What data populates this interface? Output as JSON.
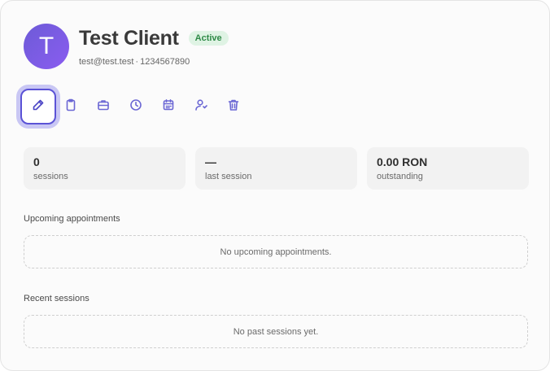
{
  "client": {
    "initial": "T",
    "name": "Test Client",
    "status": "Active",
    "email": "test@test.test",
    "separator": "·",
    "phone": "1234567890"
  },
  "toolbar": [
    {
      "name": "edit",
      "icon": "pencil-icon"
    },
    {
      "name": "notes",
      "icon": "clipboard-icon"
    },
    {
      "name": "briefcase",
      "icon": "briefcase-icon"
    },
    {
      "name": "history",
      "icon": "clock-icon"
    },
    {
      "name": "calendar",
      "icon": "calendar-icon"
    },
    {
      "name": "user",
      "icon": "user-icon"
    },
    {
      "name": "delete",
      "icon": "trash-icon"
    }
  ],
  "stats": [
    {
      "value": "0",
      "label": "sessions"
    },
    {
      "value": "—",
      "label": "last session"
    },
    {
      "value": "0.00 RON",
      "label": "outstanding"
    }
  ],
  "upcoming": {
    "title": "Upcoming appointments",
    "empty": "No upcoming appointments."
  },
  "recent": {
    "title": "Recent sessions",
    "empty": "No past sessions yet."
  },
  "colors": {
    "accent": "#5b53d6",
    "badge_bg": "#dff3e4",
    "badge_text": "#2f8a47"
  }
}
